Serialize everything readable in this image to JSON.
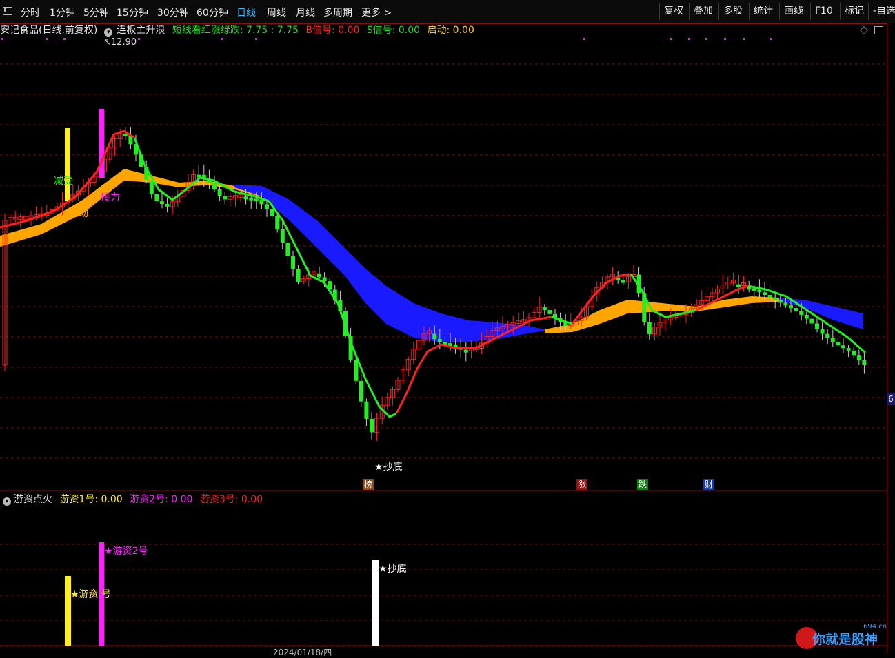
{
  "toolbar": {
    "periods": [
      "分时",
      "1分钟",
      "5分钟",
      "15分钟",
      "30分钟",
      "60分钟",
      "日线",
      "周线",
      "月线",
      "多周期",
      "更多 >"
    ],
    "active_period": "日线",
    "right_buttons": [
      "复权",
      "叠加",
      "多股",
      "统计",
      "画线",
      "F10",
      "标记",
      "-自选"
    ]
  },
  "main_panel": {
    "stock": "安记食品(日线,前复权)",
    "indicator_name": "连板主升浪",
    "legend": [
      {
        "label": "短线看红涨绿跌: 7.75 : 7.75",
        "color": "#22dd22"
      },
      {
        "label": "B信号: 0.00",
        "color": "#ff2222"
      },
      {
        "label": "S信号: 0.00",
        "color": "#22dd22"
      },
      {
        "label": "启动: 0.00",
        "color": "#ffcc00"
      }
    ],
    "high_label": "12.90",
    "annotations": {
      "jiansou": "减受",
      "jieli": "接力",
      "qidong": "启动",
      "chaodi": "★抄底"
    },
    "right_value": "6",
    "event_tags": [
      {
        "text": "榜",
        "color": "#c26a2a"
      },
      {
        "text": "涨",
        "color": "#c42222"
      },
      {
        "text": "跌",
        "color": "#22aa22"
      },
      {
        "text": "财",
        "color": "#2255cc"
      }
    ]
  },
  "sub_panel": {
    "indicator_name": "游资点火",
    "legend": [
      {
        "label": "游资1号: 0.00",
        "color": "#ffee22"
      },
      {
        "label": "游资2号: 0.00",
        "color": "#ff22ff"
      },
      {
        "label": "游资3号: 0.00",
        "color": "#ff2222"
      }
    ],
    "bar_labels": {
      "y1": "★游资 号",
      "y2": "★游资2号",
      "cd": "★抄底"
    }
  },
  "date_label": "2024/01/18/四",
  "watermark": {
    "text": "你就是股神",
    "domain": "694.cn"
  },
  "colors": {
    "up": "#ff2222",
    "down": "#22ee22",
    "band_orange": "#ffa500",
    "band_blue": "#1a1aff",
    "grid": "#7a1010"
  }
}
